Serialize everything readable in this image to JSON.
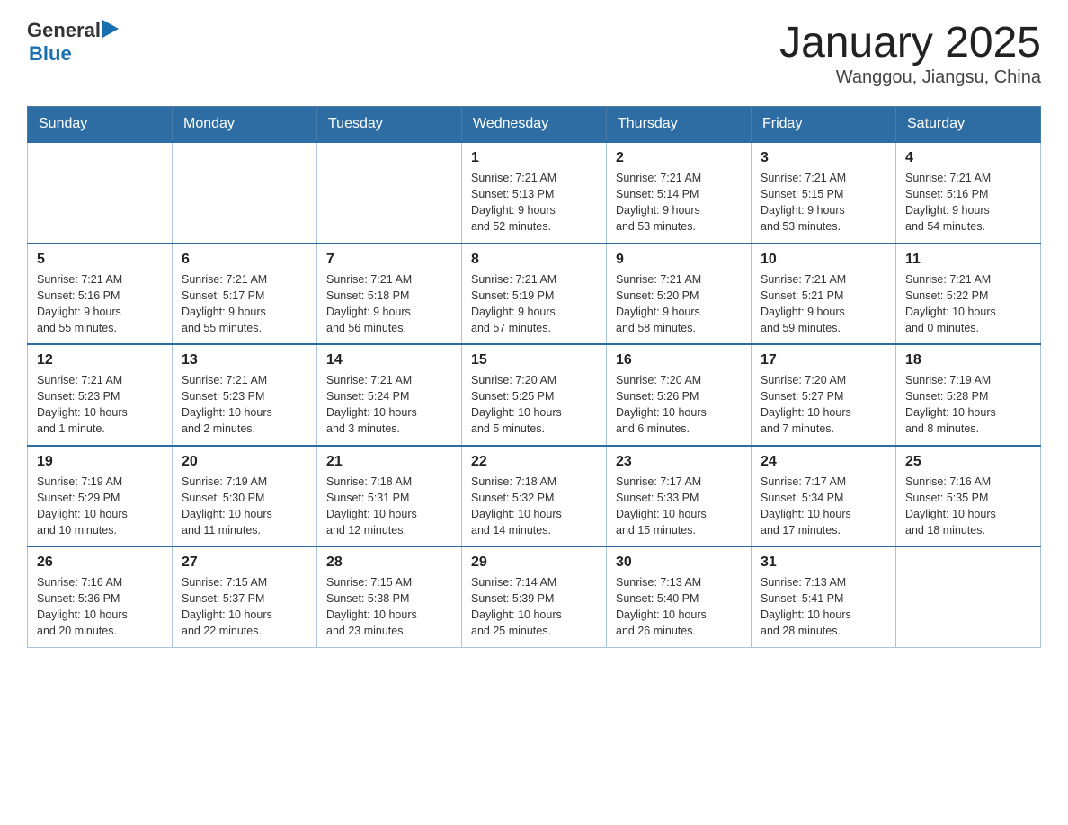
{
  "logo": {
    "text_general": "General",
    "triangle": "▶",
    "text_blue": "Blue"
  },
  "title": "January 2025",
  "subtitle": "Wanggou, Jiangsu, China",
  "days_of_week": [
    "Sunday",
    "Monday",
    "Tuesday",
    "Wednesday",
    "Thursday",
    "Friday",
    "Saturday"
  ],
  "weeks": [
    [
      {
        "day": "",
        "info": ""
      },
      {
        "day": "",
        "info": ""
      },
      {
        "day": "",
        "info": ""
      },
      {
        "day": "1",
        "info": "Sunrise: 7:21 AM\nSunset: 5:13 PM\nDaylight: 9 hours\nand 52 minutes."
      },
      {
        "day": "2",
        "info": "Sunrise: 7:21 AM\nSunset: 5:14 PM\nDaylight: 9 hours\nand 53 minutes."
      },
      {
        "day": "3",
        "info": "Sunrise: 7:21 AM\nSunset: 5:15 PM\nDaylight: 9 hours\nand 53 minutes."
      },
      {
        "day": "4",
        "info": "Sunrise: 7:21 AM\nSunset: 5:16 PM\nDaylight: 9 hours\nand 54 minutes."
      }
    ],
    [
      {
        "day": "5",
        "info": "Sunrise: 7:21 AM\nSunset: 5:16 PM\nDaylight: 9 hours\nand 55 minutes."
      },
      {
        "day": "6",
        "info": "Sunrise: 7:21 AM\nSunset: 5:17 PM\nDaylight: 9 hours\nand 55 minutes."
      },
      {
        "day": "7",
        "info": "Sunrise: 7:21 AM\nSunset: 5:18 PM\nDaylight: 9 hours\nand 56 minutes."
      },
      {
        "day": "8",
        "info": "Sunrise: 7:21 AM\nSunset: 5:19 PM\nDaylight: 9 hours\nand 57 minutes."
      },
      {
        "day": "9",
        "info": "Sunrise: 7:21 AM\nSunset: 5:20 PM\nDaylight: 9 hours\nand 58 minutes."
      },
      {
        "day": "10",
        "info": "Sunrise: 7:21 AM\nSunset: 5:21 PM\nDaylight: 9 hours\nand 59 minutes."
      },
      {
        "day": "11",
        "info": "Sunrise: 7:21 AM\nSunset: 5:22 PM\nDaylight: 10 hours\nand 0 minutes."
      }
    ],
    [
      {
        "day": "12",
        "info": "Sunrise: 7:21 AM\nSunset: 5:23 PM\nDaylight: 10 hours\nand 1 minute."
      },
      {
        "day": "13",
        "info": "Sunrise: 7:21 AM\nSunset: 5:23 PM\nDaylight: 10 hours\nand 2 minutes."
      },
      {
        "day": "14",
        "info": "Sunrise: 7:21 AM\nSunset: 5:24 PM\nDaylight: 10 hours\nand 3 minutes."
      },
      {
        "day": "15",
        "info": "Sunrise: 7:20 AM\nSunset: 5:25 PM\nDaylight: 10 hours\nand 5 minutes."
      },
      {
        "day": "16",
        "info": "Sunrise: 7:20 AM\nSunset: 5:26 PM\nDaylight: 10 hours\nand 6 minutes."
      },
      {
        "day": "17",
        "info": "Sunrise: 7:20 AM\nSunset: 5:27 PM\nDaylight: 10 hours\nand 7 minutes."
      },
      {
        "day": "18",
        "info": "Sunrise: 7:19 AM\nSunset: 5:28 PM\nDaylight: 10 hours\nand 8 minutes."
      }
    ],
    [
      {
        "day": "19",
        "info": "Sunrise: 7:19 AM\nSunset: 5:29 PM\nDaylight: 10 hours\nand 10 minutes."
      },
      {
        "day": "20",
        "info": "Sunrise: 7:19 AM\nSunset: 5:30 PM\nDaylight: 10 hours\nand 11 minutes."
      },
      {
        "day": "21",
        "info": "Sunrise: 7:18 AM\nSunset: 5:31 PM\nDaylight: 10 hours\nand 12 minutes."
      },
      {
        "day": "22",
        "info": "Sunrise: 7:18 AM\nSunset: 5:32 PM\nDaylight: 10 hours\nand 14 minutes."
      },
      {
        "day": "23",
        "info": "Sunrise: 7:17 AM\nSunset: 5:33 PM\nDaylight: 10 hours\nand 15 minutes."
      },
      {
        "day": "24",
        "info": "Sunrise: 7:17 AM\nSunset: 5:34 PM\nDaylight: 10 hours\nand 17 minutes."
      },
      {
        "day": "25",
        "info": "Sunrise: 7:16 AM\nSunset: 5:35 PM\nDaylight: 10 hours\nand 18 minutes."
      }
    ],
    [
      {
        "day": "26",
        "info": "Sunrise: 7:16 AM\nSunset: 5:36 PM\nDaylight: 10 hours\nand 20 minutes."
      },
      {
        "day": "27",
        "info": "Sunrise: 7:15 AM\nSunset: 5:37 PM\nDaylight: 10 hours\nand 22 minutes."
      },
      {
        "day": "28",
        "info": "Sunrise: 7:15 AM\nSunset: 5:38 PM\nDaylight: 10 hours\nand 23 minutes."
      },
      {
        "day": "29",
        "info": "Sunrise: 7:14 AM\nSunset: 5:39 PM\nDaylight: 10 hours\nand 25 minutes."
      },
      {
        "day": "30",
        "info": "Sunrise: 7:13 AM\nSunset: 5:40 PM\nDaylight: 10 hours\nand 26 minutes."
      },
      {
        "day": "31",
        "info": "Sunrise: 7:13 AM\nSunset: 5:41 PM\nDaylight: 10 hours\nand 28 minutes."
      },
      {
        "day": "",
        "info": ""
      }
    ]
  ]
}
